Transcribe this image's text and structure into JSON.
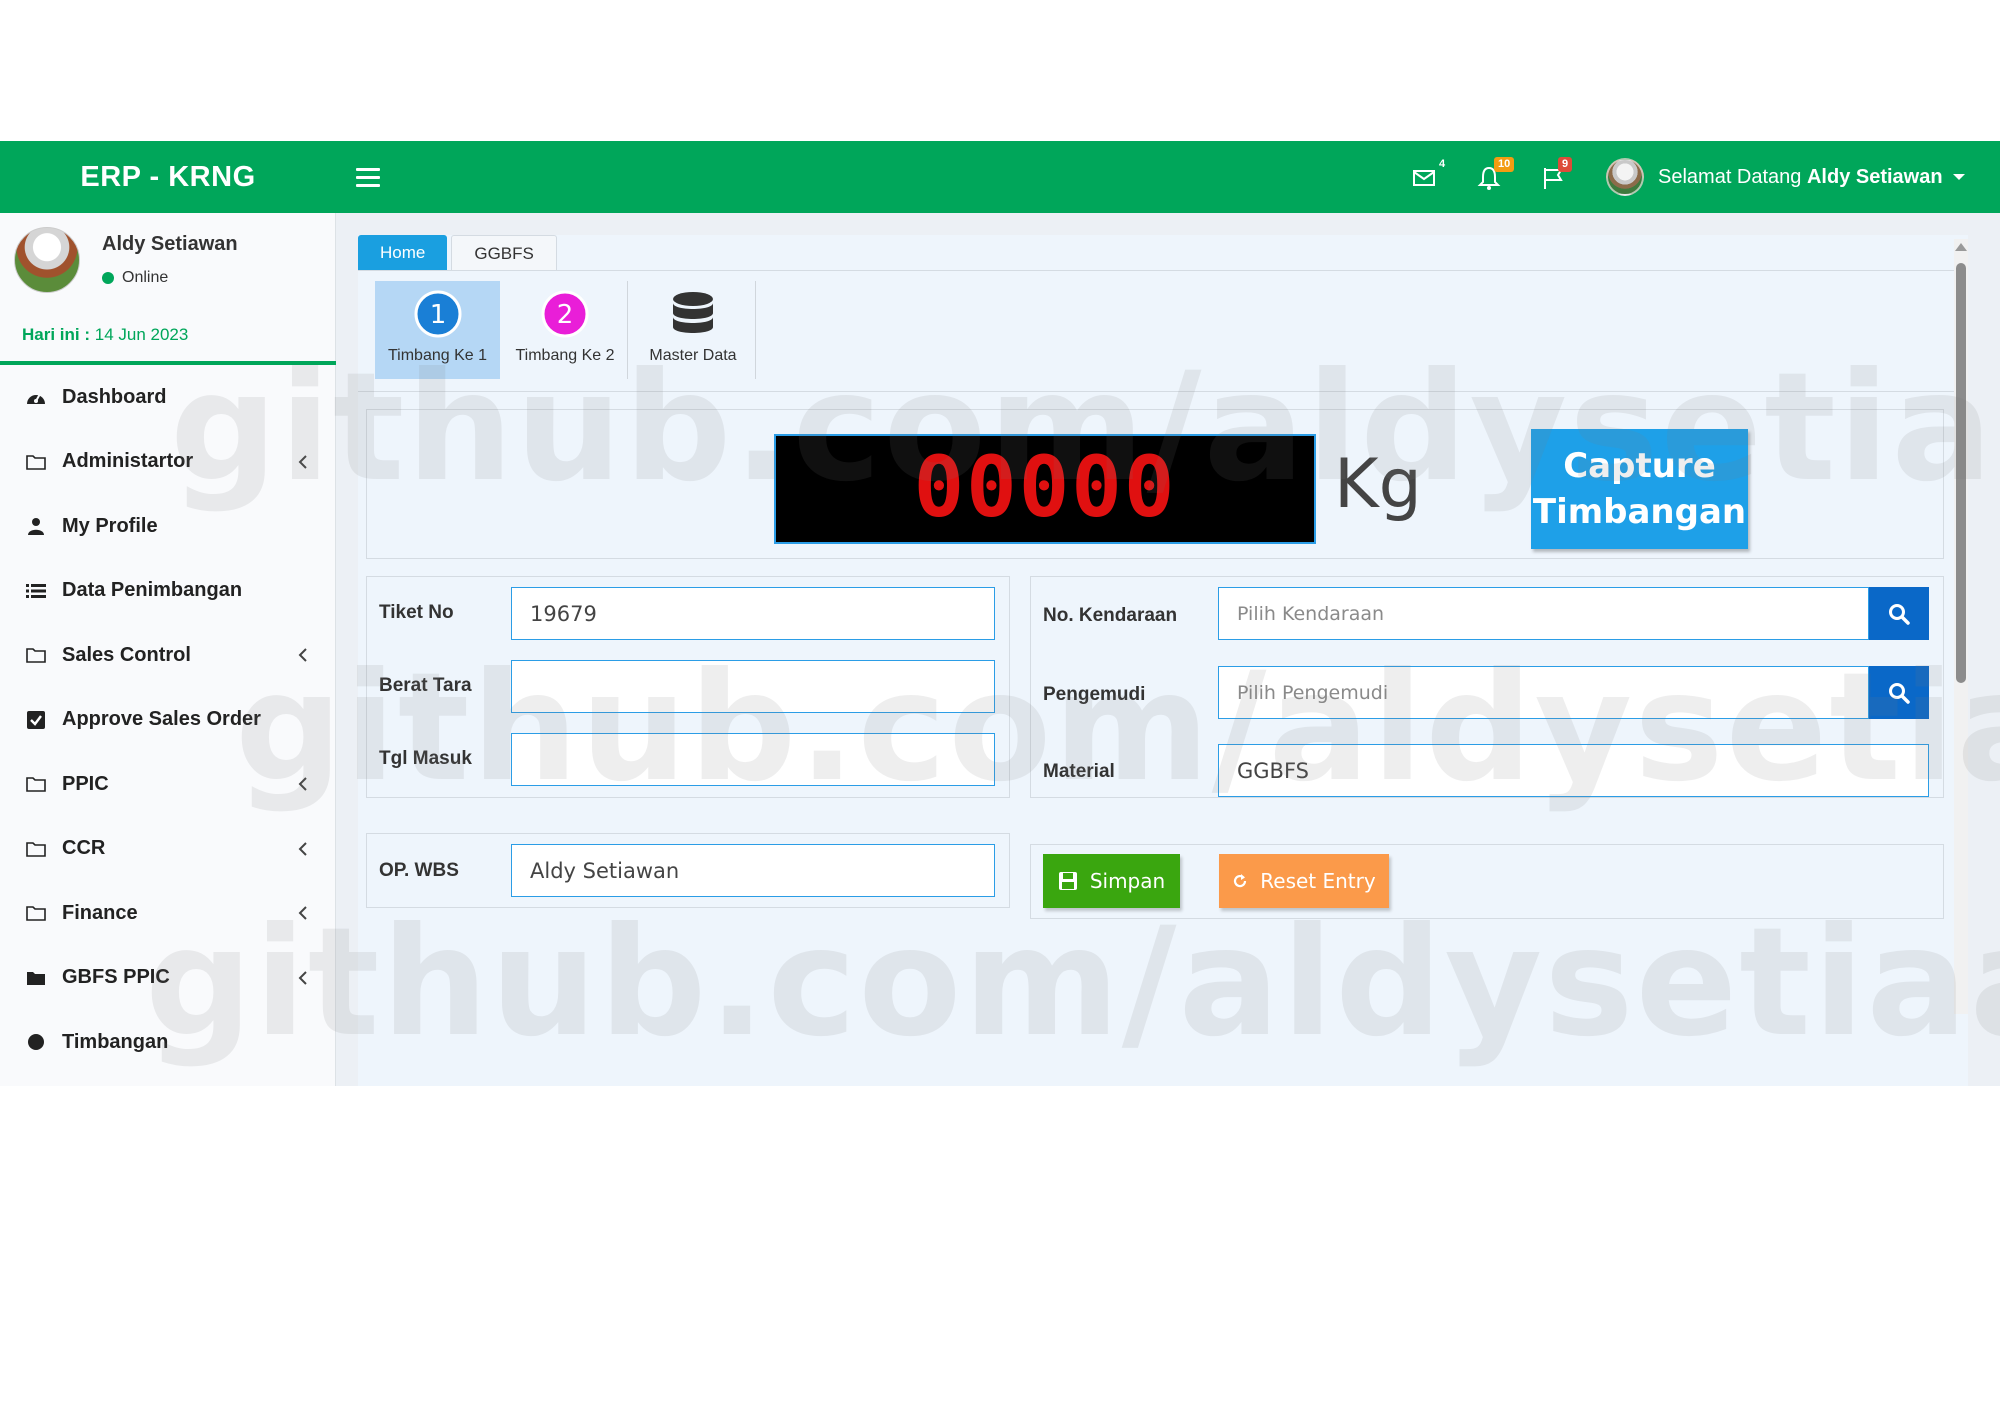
{
  "header": {
    "app_title": "ERP - KRNG",
    "mail_count": "4",
    "notif_count": "10",
    "flag_count": "9",
    "greeting": "Selamat Datang",
    "user_name": "Aldy Setiawan"
  },
  "sidebar": {
    "user_name": "Aldy Setiawan",
    "status": "Online",
    "today_label": "Hari ini :",
    "today_value": "14 Jun 2023",
    "items": [
      {
        "label": "Dashboard",
        "icon": "dashboard-icon"
      },
      {
        "label": "Administartor",
        "icon": "folder-icon"
      },
      {
        "label": "My Profile",
        "icon": "user-icon"
      },
      {
        "label": "Data Penimbangan",
        "icon": "list-icon"
      },
      {
        "label": "Sales Control",
        "icon": "folder-icon"
      },
      {
        "label": "Approve Sales Order",
        "icon": "checkbox-icon"
      },
      {
        "label": "PPIC",
        "icon": "folder-icon"
      },
      {
        "label": "CCR",
        "icon": "folder-icon"
      },
      {
        "label": "Finance",
        "icon": "folder-icon"
      },
      {
        "label": "GBFS PPIC",
        "icon": "folder-filled-icon"
      },
      {
        "label": "Timbangan",
        "icon": "circle-icon"
      }
    ]
  },
  "tabs": {
    "home": "Home",
    "ggbfs": "GGBFS"
  },
  "toolbar": {
    "t1": "Timbang Ke 1",
    "t1_num": "1",
    "t2": "Timbang Ke 2",
    "t2_num": "2",
    "master": "Master Data"
  },
  "scale": {
    "reading": "00000",
    "unit": "Kg",
    "capture_line1": "Capture",
    "capture_line2": "Timbangan"
  },
  "form": {
    "tiket_label": "Tiket No",
    "tiket_value": "19679",
    "berat_label": "Berat Tara",
    "berat_value": "",
    "tgl_label": "Tgl Masuk",
    "tgl_value": "",
    "kendaraan_label": "No. Kendaraan",
    "kendaraan_placeholder": "Pilih Kendaraan",
    "pengemudi_label": "Pengemudi",
    "pengemudi_placeholder": "Pilih Pengemudi",
    "material_label": "Material",
    "material_value": "GGBFS",
    "op_label": "OP. WBS",
    "op_value": "Aldy Setiawan"
  },
  "actions": {
    "save": "Simpan",
    "reset": "Reset Entry"
  },
  "watermark": "github.com/aldysetiaa",
  "colors": {
    "brand_green": "#00a65a",
    "primary_blue": "#1ea0e8",
    "save_green": "#3aa60f",
    "reset_orange": "#fb9a4a",
    "digit_red": "#e01010"
  }
}
